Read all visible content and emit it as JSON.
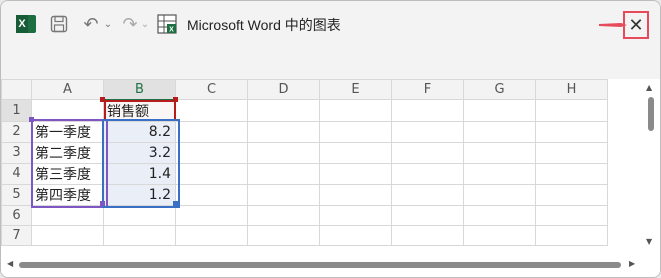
{
  "window": {
    "title": "Microsoft Word 中的图表",
    "close_glyph": "✕"
  },
  "toolbar": {
    "app_logo_letter": "X",
    "undo_glyph": "↶",
    "redo_glyph": "↷",
    "dropdown_glyph": "⌄"
  },
  "sheet": {
    "columns": [
      "A",
      "B",
      "C",
      "D",
      "E",
      "F",
      "G",
      "H"
    ],
    "rows": [
      {
        "num": "1",
        "a": "",
        "b": "销售额"
      },
      {
        "num": "2",
        "a": "第一季度",
        "b": "8.2"
      },
      {
        "num": "3",
        "a": "第二季度",
        "b": "3.2"
      },
      {
        "num": "4",
        "a": "第三季度",
        "b": "1.4"
      },
      {
        "num": "5",
        "a": "第四季度",
        "b": "1.2"
      },
      {
        "num": "6",
        "a": "",
        "b": ""
      },
      {
        "num": "7",
        "a": "",
        "b": ""
      }
    ]
  },
  "colors": {
    "excel_green": "#1d6f42",
    "series_name_range": "#b71c1c",
    "category_range": "#7e57c2",
    "value_range": "#3a6fc6",
    "close_highlight": "#e64a5b"
  }
}
